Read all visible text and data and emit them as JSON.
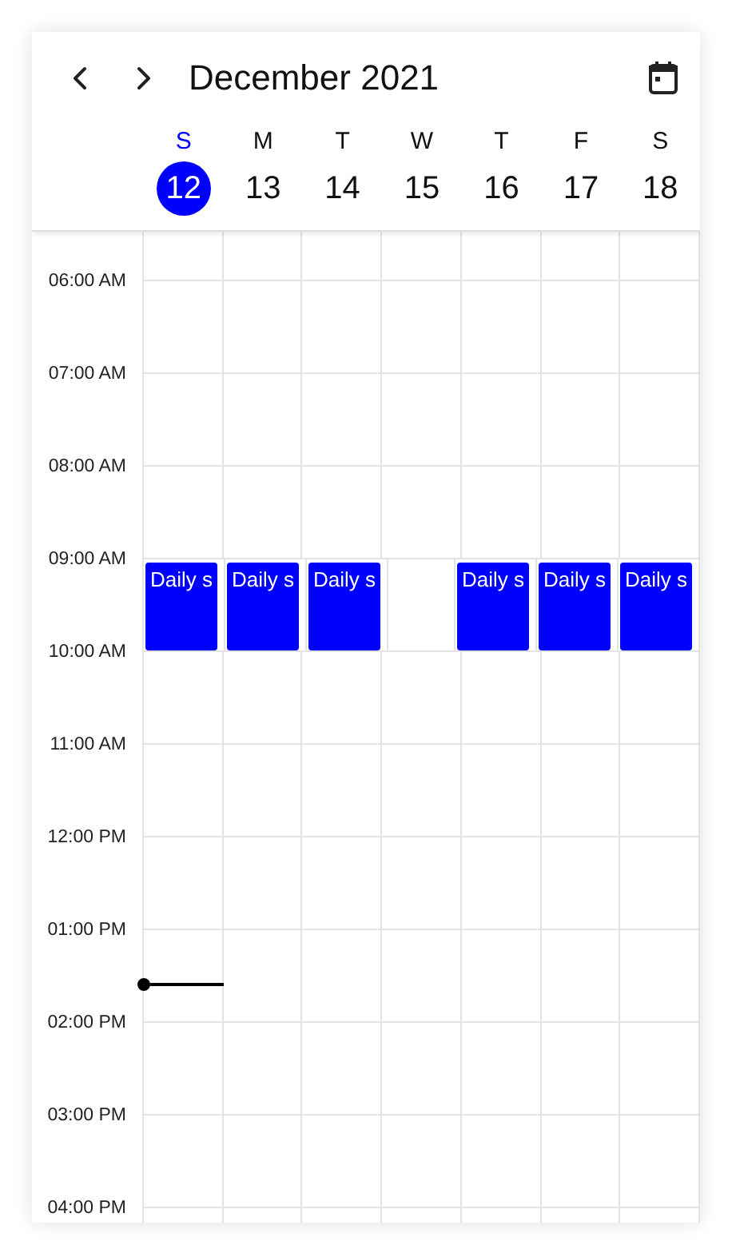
{
  "header": {
    "title": "December 2021"
  },
  "days": [
    {
      "letter": "S",
      "number": "12",
      "selected": true
    },
    {
      "letter": "M",
      "number": "13",
      "selected": false
    },
    {
      "letter": "T",
      "number": "14",
      "selected": false
    },
    {
      "letter": "W",
      "number": "15",
      "selected": false
    },
    {
      "letter": "T",
      "number": "16",
      "selected": false
    },
    {
      "letter": "F",
      "number": "17",
      "selected": false
    },
    {
      "letter": "S",
      "number": "18",
      "selected": false
    }
  ],
  "hours": [
    {
      "label": "06:00 AM"
    },
    {
      "label": "07:00 AM"
    },
    {
      "label": "08:00 AM"
    },
    {
      "label": "09:00 AM",
      "slots": [
        {
          "kind": "event",
          "title": "Daily s"
        },
        {
          "kind": "event",
          "title": "Daily s"
        },
        {
          "kind": "event",
          "title": "Daily s"
        },
        {
          "kind": "empty"
        },
        {
          "kind": "event",
          "title": "Daily s"
        },
        {
          "kind": "event",
          "title": "Daily s"
        },
        {
          "kind": "event",
          "title": "Daily s"
        }
      ]
    },
    {
      "label": "10:00 AM"
    },
    {
      "label": "11:00 AM"
    },
    {
      "label": "12:00 PM"
    },
    {
      "label": "01:00 PM",
      "now_line": true
    },
    {
      "label": "02:00 PM"
    },
    {
      "label": "03:00 PM"
    },
    {
      "label": "04:00 PM"
    }
  ]
}
